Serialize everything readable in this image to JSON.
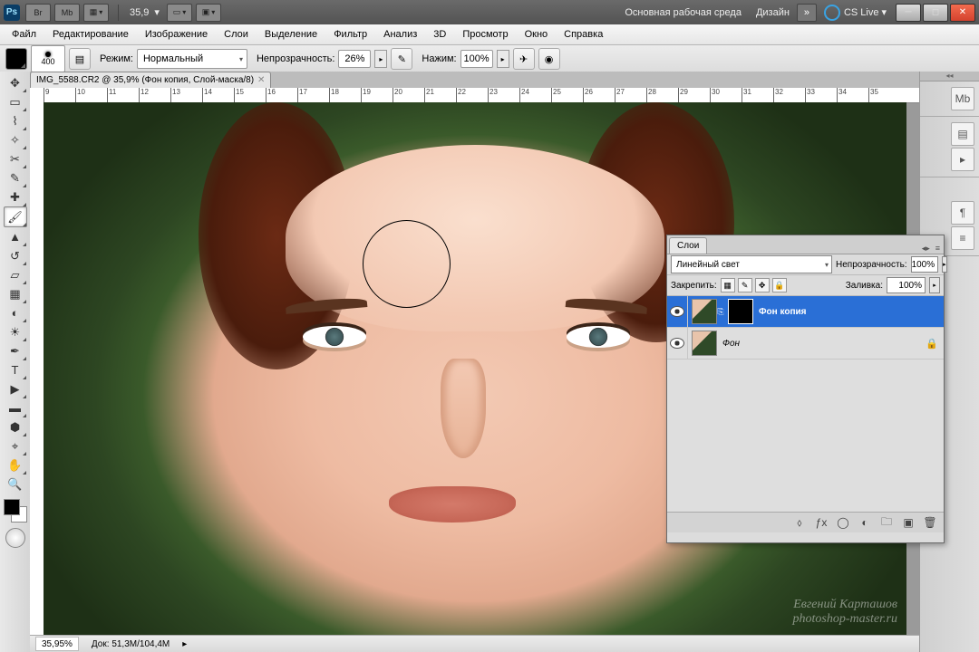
{
  "topbar": {
    "br_label": "Br",
    "mb_label": "Mb",
    "zoom": "35,9",
    "workspace_main": "Основная рабочая среда",
    "workspace_design": "Дизайн",
    "cslive": "CS Live"
  },
  "menu": {
    "file": "Файл",
    "edit": "Редактирование",
    "image": "Изображение",
    "layer": "Слои",
    "select": "Выделение",
    "filter": "Фильтр",
    "analysis": "Анализ",
    "threeD": "3D",
    "view": "Просмотр",
    "window": "Окно",
    "help": "Справка"
  },
  "options": {
    "brush_size": "400",
    "mode_label": "Режим:",
    "mode_value": "Нормальный",
    "opacity_label": "Непрозрачность:",
    "opacity_value": "26%",
    "flow_label": "Нажим:",
    "flow_value": "100%"
  },
  "document": {
    "tab_title": "IMG_5588.CR2 @ 35,9% (Фон копия, Слой-маска/8)"
  },
  "ruler_ticks": [
    "9",
    "10",
    "11",
    "12",
    "13",
    "14",
    "15",
    "16",
    "17",
    "18",
    "19",
    "20",
    "21",
    "22",
    "23",
    "24",
    "25",
    "26",
    "27",
    "28",
    "29",
    "30",
    "31",
    "32",
    "33",
    "34",
    "35"
  ],
  "layers_panel": {
    "tab": "Слои",
    "blend_mode": "Линейный свет",
    "opacity_label": "Непрозрачность:",
    "opacity_value": "100%",
    "lock_label": "Закрепить:",
    "fill_label": "Заливка:",
    "fill_value": "100%",
    "layers": [
      {
        "name": "Фон копия",
        "selected": true,
        "has_mask": true
      },
      {
        "name": "Фон",
        "selected": false,
        "locked": true
      }
    ]
  },
  "status": {
    "zoom": "35,95%",
    "doc_label": "Док:",
    "doc_value": "51,3M/104,4M"
  },
  "watermark": {
    "line1": "Евгений Карташов",
    "line2": "photoshop-master.ru"
  }
}
